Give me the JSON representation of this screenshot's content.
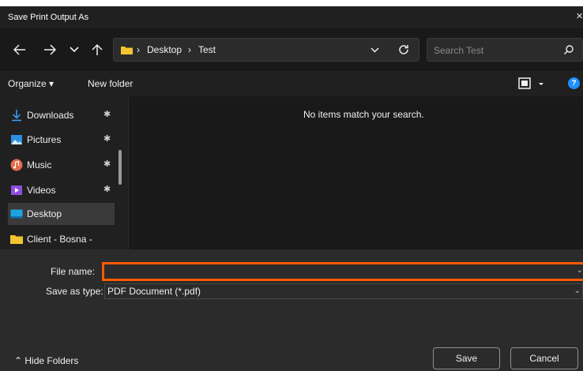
{
  "window": {
    "title": "Save Print Output As",
    "close": "×"
  },
  "nav": {
    "back": "←",
    "forward": "→",
    "recent": "⌄",
    "up": "↑"
  },
  "address": {
    "crumbs": [
      "Desktop",
      "Test"
    ],
    "separator": "›"
  },
  "search": {
    "placeholder": "Search Test"
  },
  "commands": {
    "organize": "Organize ▾",
    "new_folder": "New folder",
    "help": "?"
  },
  "sidebar": {
    "items": [
      {
        "label": "Downloads",
        "icon": "download-icon",
        "pinned": true
      },
      {
        "label": "Pictures",
        "icon": "pictures-icon",
        "pinned": true
      },
      {
        "label": "Music",
        "icon": "music-icon",
        "pinned": true
      },
      {
        "label": "Videos",
        "icon": "videos-icon",
        "pinned": true
      },
      {
        "label": "Desktop",
        "icon": "desktop-icon",
        "pinned": false,
        "selected": true
      },
      {
        "label": "Client - Bosna -",
        "icon": "folder-icon",
        "pinned": false
      }
    ],
    "pin_glyph": "✱"
  },
  "content": {
    "empty_message": "No items match your search."
  },
  "form": {
    "file_name_label": "File name:",
    "file_name_value": "",
    "save_type_label": "Save as type:",
    "save_type_value": "PDF Document (*.pdf)"
  },
  "footer": {
    "hide_folders": "⌃ Hide Folders",
    "save": "Save",
    "cancel": "Cancel"
  },
  "colors": {
    "accent_focus": "#ff5a00",
    "folder_yellow": "#f4c430",
    "help_blue": "#1e90ff"
  }
}
